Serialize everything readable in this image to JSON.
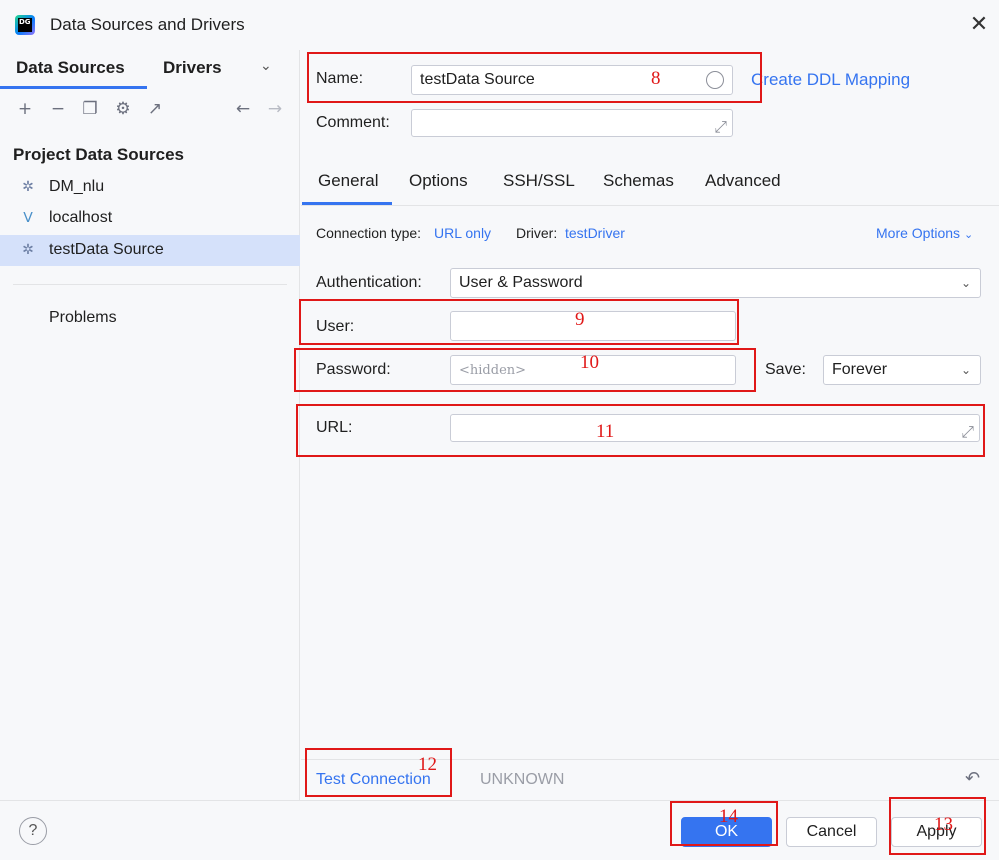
{
  "window": {
    "title": "Data Sources and Drivers",
    "logo_text": "DG",
    "close_glyph": "✕"
  },
  "left": {
    "tabs": [
      "Data Sources",
      "Drivers"
    ],
    "tab_menu_glyph": "⌄",
    "toolbar_icons": [
      "add-icon",
      "remove-icon",
      "duplicate-icon",
      "settings-icon",
      "export-icon",
      "back-icon",
      "forward-icon"
    ],
    "section_title": "Project Data Sources",
    "items": [
      {
        "label": "DM_nlu",
        "icon": "datasource-icon"
      },
      {
        "label": "localhost",
        "icon": "mysql-icon"
      },
      {
        "label": "testData Source",
        "icon": "datasource-icon",
        "selected": true
      }
    ],
    "problems_label": "Problems"
  },
  "form": {
    "name_label": "Name:",
    "name_value": "testData Source",
    "ddl_link": "Create DDL Mapping",
    "comment_label": "Comment:",
    "comment_value": "",
    "tabs": [
      "General",
      "Options",
      "SSH/SSL",
      "Schemas",
      "Advanced"
    ],
    "active_tab": "General",
    "connection_type_label": "Connection type:",
    "connection_type_value": "URL only",
    "driver_label": "Driver:",
    "driver_value": "testDriver",
    "more_options": "More Options",
    "auth_label": "Authentication:",
    "auth_value": "User & Password",
    "user_label": "User:",
    "user_value": "",
    "password_label": "Password:",
    "password_placeholder": "<hidden>",
    "save_label": "Save:",
    "save_value": "Forever",
    "url_label": "URL:",
    "url_value": ""
  },
  "footer": {
    "test_connection": "Test Connection",
    "status": "UNKNOWN",
    "help": "?",
    "ok": "OK",
    "cancel": "Cancel",
    "apply": "Apply"
  },
  "annotations": {
    "a8": "8",
    "a9": "9",
    "a10": "10",
    "a11": "11",
    "a12": "12",
    "a13": "13",
    "a14": "14"
  },
  "colors": {
    "accent": "#3574f0",
    "selection": "#d5e1fa",
    "annotation": "#e01818"
  }
}
